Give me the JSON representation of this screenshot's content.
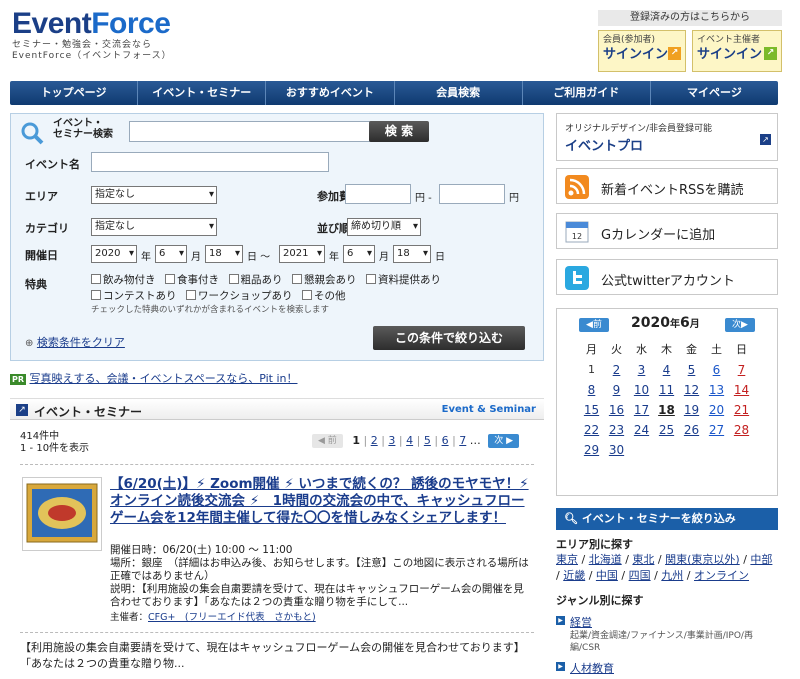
{
  "header": {
    "logo_event": "Event",
    "logo_force": "Force",
    "tagline1": "セミナー・勉強会・交流会なら",
    "tagline2": "EventForce（イベントフォース）",
    "signin_caption": "登録済みの方はこちらから",
    "member_small": "会員(参加者)",
    "member_big": "サインイン",
    "organizer_small": "イベント主催者",
    "organizer_big": "サインイン"
  },
  "nav": [
    "トップページ",
    "イベント・セミナー",
    "おすすめイベント",
    "会員検索",
    "ご利用ガイド",
    "マイページ"
  ],
  "search": {
    "label_keyword_1": "イベント・",
    "label_keyword_2": "セミナー検索",
    "button": "検 索",
    "label_event_name": "イベント名",
    "label_area": "エリア",
    "area_value": "指定なし",
    "label_fee": "参加費",
    "fee_unit1": "円 -",
    "fee_unit2": "円",
    "label_category": "カテゴリ",
    "category_value": "指定なし",
    "label_sort": "並び順",
    "sort_value": "締め切り順",
    "label_date": "開催日",
    "from_year": "2020",
    "from_year_unit": "年",
    "from_month": "6",
    "from_month_unit": "月",
    "from_day": "18",
    "from_day_unit": "日 ～",
    "to_year": "2021",
    "to_year_unit": "年",
    "to_month": "6",
    "to_month_unit": "月",
    "to_day": "18",
    "to_day_unit": "日",
    "label_perks": "特典",
    "perks_row1": [
      "飲み物付き",
      "食事付き",
      "粗品あり",
      "懇親会あり",
      "資料提供あり"
    ],
    "perks_row2": [
      "コンテストあり",
      "ワークショップあり",
      "その他"
    ],
    "perks_note": "チェックした特典のいずれかが含まれるイベントを検索します",
    "clear_link": "検索条件をクリア",
    "narrow_button": "この条件で絞り込む"
  },
  "pr": {
    "badge": "PR",
    "text": "写真映えする、会議・イベントスペースなら、Pit in！"
  },
  "listing": {
    "title": "イベント・セミナー",
    "title_en": "Event & Seminar",
    "count": "414件中",
    "range": "1 - 10件を表示",
    "prev": "前",
    "pages": [
      "1",
      "2",
      "3",
      "4",
      "5",
      "6",
      "7"
    ],
    "ellipsis": "…",
    "next": "次"
  },
  "event": {
    "title": "【6/20(土)】⚡ Zoom開催 ⚡ いつまで続くの？ 誘後のモヤモヤ！⚡ オンライン読後交流会 ⚡　1時間の交流会の中で、キャッシュフローゲーム会を12年間主催して得た〇〇を惜しみなくシェアします！",
    "datetime": "開催日時：06/20(土) 10:00 ～ 11:00",
    "place": "場所：銀座　（詳細はお申込み後、お知らせします。【注意】この地図に表示される場所は正確ではありません）",
    "desc": "説明：【利用施設の集会自粛要請を受けて、現在はキャッシュフローゲーム会の開催を見合わせております】「あなたは２つの貴重な贈り物を手にして...",
    "organizer_label": "主催者：",
    "organizer_link": "CFG+　(フリーエイド代表　さかもと)",
    "excerpt": "【利用施設の集会自粛要請を受けて、現在はキャッシュフローゲーム会の開催を見合わせております】「あなたは２つの貴重な贈り物..."
  },
  "side": {
    "pro_small": "オリジナルデザイン/非会員登録可能",
    "pro_big": "イベントプロ",
    "rss": "新着イベントRSSを購読",
    "gcal": "Gカレンダーに追加",
    "gcal_icon_num": "12",
    "twitter": "公式twitterアカウント"
  },
  "calendar": {
    "prev": "前",
    "next": "次",
    "year": "2020",
    "year_unit": "年",
    "month": "6",
    "month_unit": "月",
    "weekdays": [
      "月",
      "火",
      "水",
      "木",
      "金",
      "土",
      "日"
    ],
    "days": [
      "1",
      "2",
      "3",
      "4",
      "5",
      "6",
      "7",
      "8",
      "9",
      "10",
      "11",
      "12",
      "13",
      "14",
      "15",
      "16",
      "17",
      "18",
      "19",
      "20",
      "21",
      "22",
      "23",
      "24",
      "25",
      "26",
      "27",
      "28",
      "29",
      "30"
    ]
  },
  "narrow": {
    "head": "イベント・セミナーを絞り込み",
    "area_title": "エリア別に探す",
    "areas": [
      "東京",
      "北海道",
      "東北",
      "関東(東京以外)",
      "中部",
      "近畿",
      "中国",
      "四国",
      "九州",
      "オンライン"
    ],
    "genre_title": "ジャンル別に探す",
    "genre1": "経営",
    "genre1_desc": "起業/資金調達/ファイナンス/事業計画/IPO/再編/CSR",
    "genre2": "人材教育"
  }
}
